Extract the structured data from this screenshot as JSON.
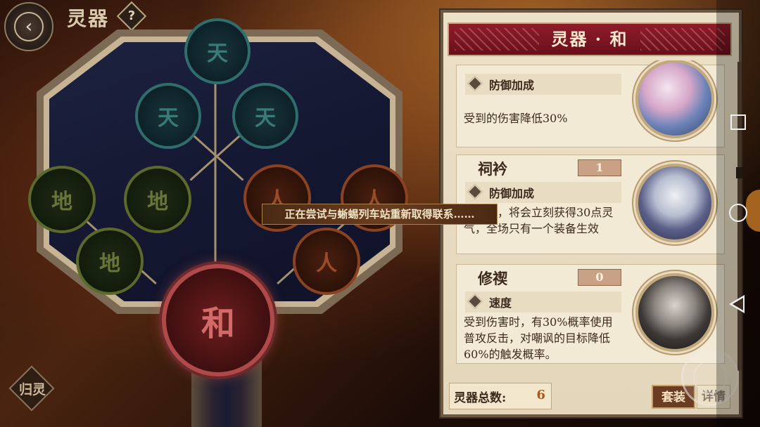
{
  "header": {
    "back_icon": "back-arrow-icon",
    "title": "灵器",
    "help_label": "?"
  },
  "tree": {
    "tian": [
      "天",
      "天",
      "天"
    ],
    "di": [
      "地",
      "地",
      "地"
    ],
    "ren": [
      "人",
      "人",
      "人"
    ],
    "center": "和",
    "return_label": "归灵"
  },
  "toast": "正在尝试与蜥蜴列车站重新取得联系……",
  "panel": {
    "title": "灵器 · 和",
    "cards": [
      {
        "name": "",
        "level": "",
        "attr": "防御加成",
        "attr_icon": "shield-diamond-icon",
        "desc": "受到的伤害降低30%"
      },
      {
        "name": "祠衿",
        "level": "1",
        "attr": "防御加成",
        "attr_icon": "shield-diamond-icon",
        "desc": "阵亡时，将会立刻获得30点灵气，全场只有一个装备生效"
      },
      {
        "name": "修禊",
        "level": "0",
        "attr": "速度",
        "attr_icon": "speed-diamond-icon",
        "desc": "受到伤害时，有30%概率使用普攻反击，对嘲讽的目标降低60%的触发概率。"
      }
    ],
    "total_label": "灵器总数:",
    "total_value": "6",
    "set_button": "套装",
    "detail_button": "详情"
  },
  "android_nav": {
    "recents": "square-icon",
    "home": "circle-icon",
    "back": "triangle-back-icon"
  }
}
